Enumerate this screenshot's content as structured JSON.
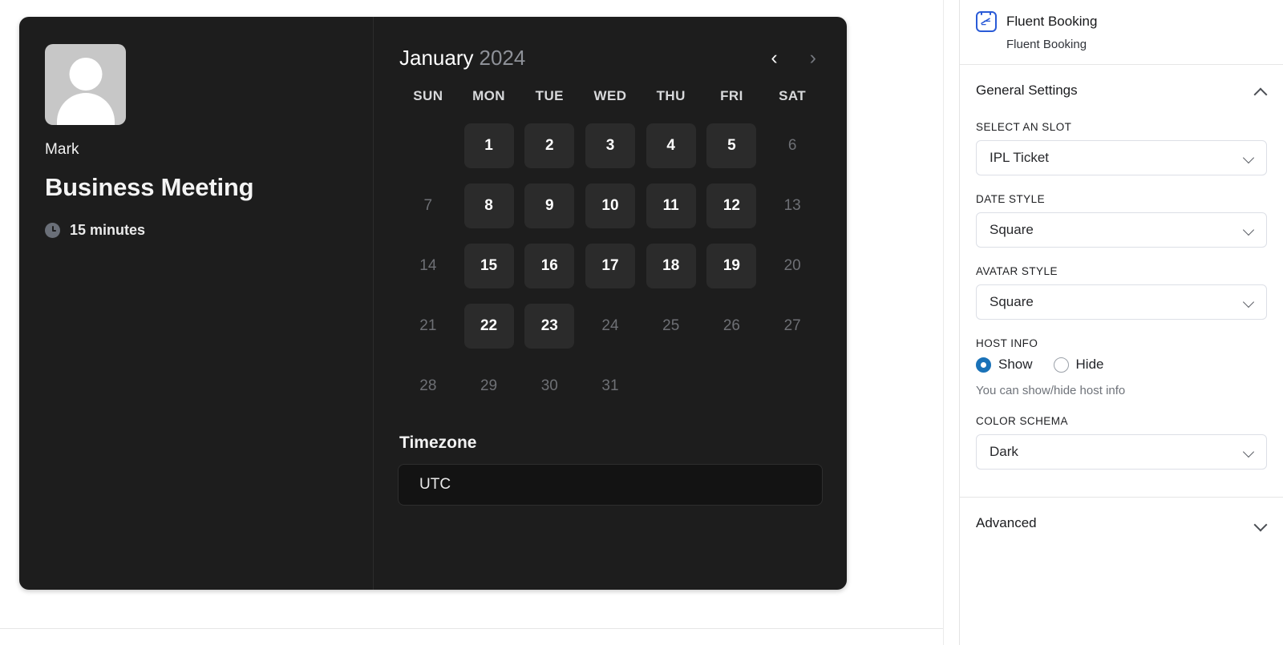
{
  "toolbar": {
    "cells": [
      "",
      "",
      ""
    ]
  },
  "preview": {
    "host": {
      "avatar_icon": "user-avatar-placeholder-icon",
      "name": "Mark"
    },
    "event_title": "Business Meeting",
    "duration": {
      "icon": "clock-icon",
      "text": "15 minutes"
    },
    "calendar": {
      "month": "January",
      "year": "2024",
      "prev_icon": "chevron-left-icon",
      "next_icon": "chevron-right-icon",
      "weekdays": [
        "SUN",
        "MON",
        "TUE",
        "WED",
        "THU",
        "FRI",
        "SAT"
      ],
      "weeks": [
        [
          {
            "day": "",
            "state": "empty"
          },
          {
            "day": "1",
            "state": "available"
          },
          {
            "day": "2",
            "state": "available"
          },
          {
            "day": "3",
            "state": "available"
          },
          {
            "day": "4",
            "state": "available"
          },
          {
            "day": "5",
            "state": "available"
          },
          {
            "day": "6",
            "state": "off"
          }
        ],
        [
          {
            "day": "7",
            "state": "off"
          },
          {
            "day": "8",
            "state": "available"
          },
          {
            "day": "9",
            "state": "available"
          },
          {
            "day": "10",
            "state": "available"
          },
          {
            "day": "11",
            "state": "available"
          },
          {
            "day": "12",
            "state": "available"
          },
          {
            "day": "13",
            "state": "off"
          }
        ],
        [
          {
            "day": "14",
            "state": "off"
          },
          {
            "day": "15",
            "state": "available"
          },
          {
            "day": "16",
            "state": "available"
          },
          {
            "day": "17",
            "state": "available"
          },
          {
            "day": "18",
            "state": "available"
          },
          {
            "day": "19",
            "state": "available"
          },
          {
            "day": "20",
            "state": "off"
          }
        ],
        [
          {
            "day": "21",
            "state": "off"
          },
          {
            "day": "22",
            "state": "available"
          },
          {
            "day": "23",
            "state": "available"
          },
          {
            "day": "24",
            "state": "off"
          },
          {
            "day": "25",
            "state": "off"
          },
          {
            "day": "26",
            "state": "off"
          },
          {
            "day": "27",
            "state": "off"
          }
        ],
        [
          {
            "day": "28",
            "state": "off"
          },
          {
            "day": "29",
            "state": "off"
          },
          {
            "day": "30",
            "state": "off"
          },
          {
            "day": "31",
            "state": "off"
          },
          {
            "day": "",
            "state": "empty"
          },
          {
            "day": "",
            "state": "empty"
          },
          {
            "day": "",
            "state": "empty"
          }
        ]
      ]
    },
    "timezone": {
      "label": "Timezone",
      "value": "UTC"
    }
  },
  "sidebar": {
    "plugin": {
      "icon": "fluent-booking-icon",
      "name": "Fluent Booking",
      "subtitle": "Fluent Booking"
    },
    "general_settings": {
      "title": "General Settings",
      "collapse_icon": "chevron-up-icon",
      "fields": {
        "slot": {
          "label": "SELECT AN SLOT",
          "value": "IPL Ticket",
          "chevron": "chevron-down-icon"
        },
        "date_style": {
          "label": "DATE STYLE",
          "value": "Square",
          "chevron": "chevron-down-icon"
        },
        "avatar_style": {
          "label": "AVATAR STYLE",
          "value": "Square",
          "chevron": "chevron-down-icon"
        },
        "host_info": {
          "label": "HOST INFO",
          "options": [
            {
              "label": "Show",
              "selected": true
            },
            {
              "label": "Hide",
              "selected": false
            }
          ],
          "help": "You can show/hide host info"
        },
        "color_schema": {
          "label": "COLOR SCHEMA",
          "value": "Dark",
          "chevron": "chevron-down-icon"
        }
      }
    },
    "advanced": {
      "title": "Advanced",
      "expand_icon": "chevron-down-icon"
    },
    "scrollbar": {
      "name": "sidebar-scrollbar"
    }
  },
  "colors": {
    "card_bg": "#1d1d1d",
    "day_available_bg": "#2b2b2b",
    "accent_blue": "#1a72b8",
    "plugin_blue": "#2a5bd7",
    "page_bg": "#ffffff"
  }
}
